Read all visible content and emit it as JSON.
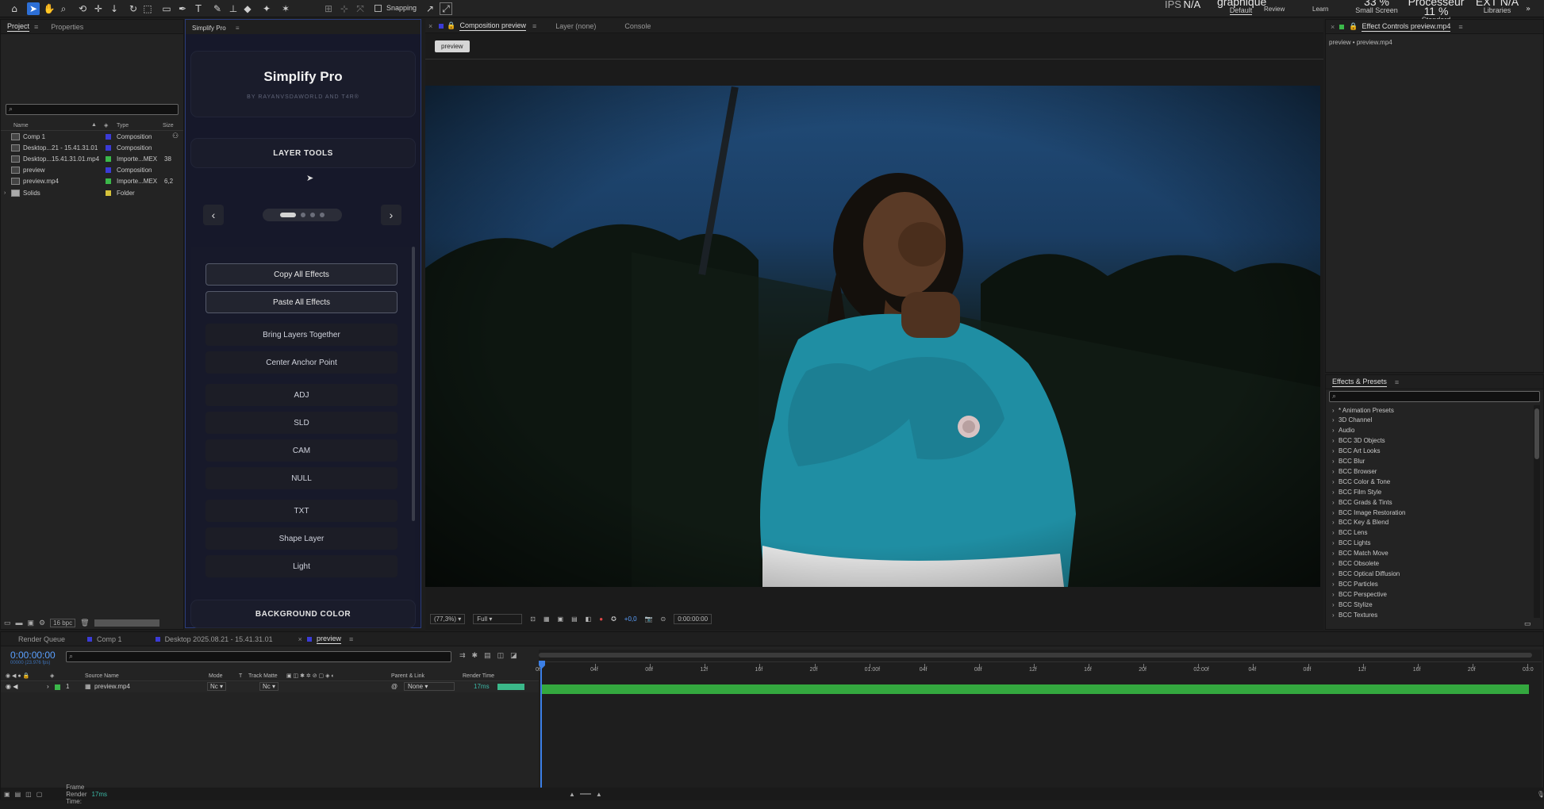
{
  "toolbar": {
    "snapping_label": "Snapping",
    "workspaces": [
      {
        "top": "IPS",
        "big": "N/A",
        "label": ""
      },
      {
        "top": "",
        "big": "graphique",
        "label": "Default"
      },
      {
        "top": "",
        "big": "",
        "label": "Review"
      },
      {
        "top": "",
        "big": "",
        "label": "Learn"
      },
      {
        "top": "",
        "big": "33 %",
        "label": "Small Screen"
      },
      {
        "top": "Processeur",
        "big": "11 %",
        "label": "Standard"
      },
      {
        "top": "EXT",
        "big": "N/A",
        "label": "Libraries"
      }
    ]
  },
  "project": {
    "tabs": [
      "Project",
      "Properties"
    ],
    "columns": [
      "Name",
      "Type",
      "Size"
    ],
    "items": [
      {
        "name": "Comp 1",
        "type": "Composition",
        "size": "",
        "color": "#3b3bd6"
      },
      {
        "name": "Desktop...21 - 15.41.31.01",
        "type": "Composition",
        "size": "",
        "color": "#3b3bd6"
      },
      {
        "name": "Desktop...15.41.31.01.mp4",
        "type": "Importe...MEX",
        "size": "38",
        "color": "#3bb84a"
      },
      {
        "name": "preview",
        "type": "Composition",
        "size": "",
        "color": "#3b3bd6"
      },
      {
        "name": "preview.mp4",
        "type": "Importe...MEX",
        "size": "6,2",
        "color": "#3bb84a"
      },
      {
        "name": "Solids",
        "type": "Folder",
        "size": "",
        "color": "#d6c23b"
      }
    ],
    "bpc": "16 bpc"
  },
  "simplify": {
    "panel_tab": "Simplify Pro",
    "title": "Simplify Pro",
    "subtitle": "BY RAYANVSDAWORLD AND T4R®",
    "section": "LAYER TOOLS",
    "nav_prev": "‹",
    "nav_next": "›",
    "buttons": [
      "Copy All Effects",
      "Paste All Effects",
      "Bring Layers Together",
      "Center Anchor Point",
      "ADJ",
      "SLD",
      "CAM",
      "NULL",
      "TXT",
      "Shape Layer",
      "Light"
    ],
    "bottom_section": "BACKGROUND COLOR"
  },
  "composition": {
    "tabs": [
      "Composition preview",
      "Layer (none)",
      "Console"
    ],
    "sub_tab": "preview",
    "zoom": "(77,3%)",
    "quality": "Full",
    "exposure": "+0,0",
    "timecode": "0:00:00:00"
  },
  "effect_controls": {
    "tab": "Effect Controls preview.mp4",
    "subtitle": "preview • preview.mp4"
  },
  "effects_presets": {
    "title": "Effects & Presets",
    "items": [
      "* Animation Presets",
      "3D Channel",
      "Audio",
      "BCC 3D Objects",
      "BCC Art Looks",
      "BCC Blur",
      "BCC Browser",
      "BCC Color & Tone",
      "BCC Film Style",
      "BCC Grads & Tints",
      "BCC Image Restoration",
      "BCC Key & Blend",
      "BCC Lens",
      "BCC Lights",
      "BCC Match Move",
      "BCC Obsolete",
      "BCC Optical Diffusion",
      "BCC Particles",
      "BCC Perspective",
      "BCC Stylize",
      "BCC Textures"
    ]
  },
  "timeline": {
    "tabs": [
      "Render Queue",
      "Comp 1",
      "Desktop 2025.08.21 - 15.41.31.01",
      "preview"
    ],
    "timecode": "0:00:00:00",
    "timecode_sub": "00000 (23.976 fps)",
    "columns": [
      "Source Name",
      "Mode",
      "T",
      "Track Matte",
      "Parent & Link",
      "Render Time"
    ],
    "layer": {
      "index": "1",
      "name": "preview.mp4",
      "mode": "Nc",
      "matte": "Nc",
      "parent": "None",
      "render": "17ms"
    },
    "ruler": [
      "0f",
      "04f",
      "08f",
      "12f",
      "16f",
      "20f",
      "01:00f",
      "04f",
      "08f",
      "12f",
      "16f",
      "20f",
      "02:00f",
      "04f",
      "08f",
      "12f",
      "16f",
      "20f",
      "03:0"
    ],
    "status_label": "Frame Render Time:",
    "status_value": "17ms"
  }
}
